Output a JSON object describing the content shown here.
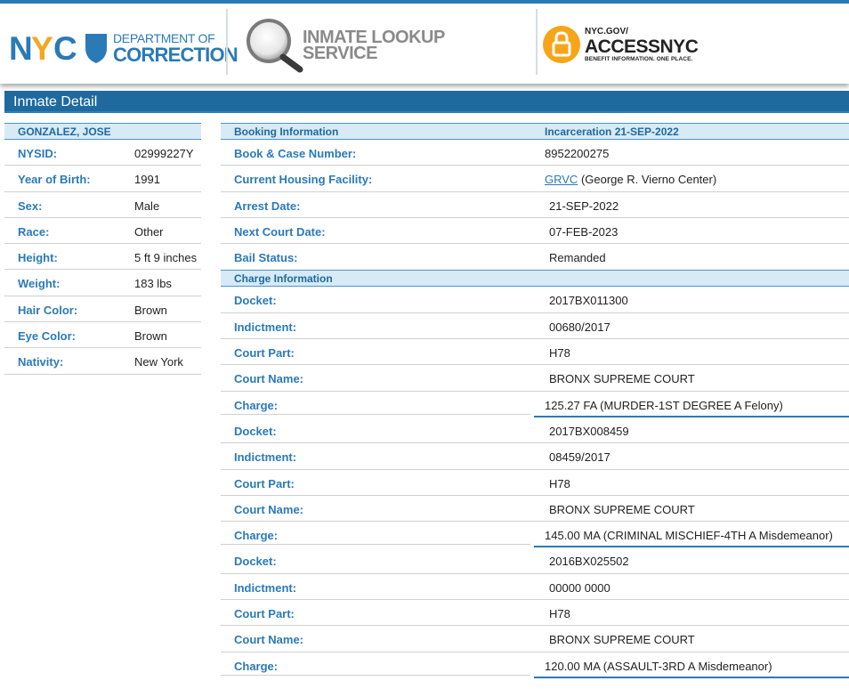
{
  "header": {
    "doc_line1": "DEPARTMENT OF",
    "doc_line2": "CORRECTION",
    "lookup_line1": "INMATE LOOKUP",
    "lookup_line2": "SERVICE",
    "access_line1": "NYC.GOV/",
    "access_line2": "ACCESSNYC",
    "access_line3": "BENEFIT INFORMATION. ONE PLACE.",
    "colors": {
      "brand_blue": "#2a7ab8",
      "nyc_orange": "#f5a623",
      "access_orange": "#f6a51b"
    }
  },
  "title": "Inmate Detail",
  "inmate": {
    "name": "GONZALEZ, JOSE",
    "fields": [
      {
        "label": "NYSID:",
        "value": "02999227Y"
      },
      {
        "label": "Year of Birth:",
        "value": "1991"
      },
      {
        "label": "Sex:",
        "value": "Male"
      },
      {
        "label": "Race:",
        "value": "Other"
      },
      {
        "label": "Height:",
        "value": "5 ft 9 inches"
      },
      {
        "label": "Weight:",
        "value": "183 lbs"
      },
      {
        "label": "Hair Color:",
        "value": "Brown"
      },
      {
        "label": "Eye Color:",
        "value": "Brown"
      },
      {
        "label": "Nativity:",
        "value": "New York"
      }
    ]
  },
  "booking": {
    "header_label": "Booking Information",
    "header_value": "Incarceration 21-SEP-2022",
    "book_case_label": "Book & Case Number:",
    "book_case_value": "8952200275",
    "facility_label": "Current Housing Facility:",
    "facility_link": "GRVC",
    "facility_name": "(George R. Vierno Center)",
    "arrest_label": "Arrest Date:",
    "arrest_value": "21-SEP-2022",
    "next_court_label": "Next Court Date:",
    "next_court_value": "07-FEB-2023",
    "bail_label": "Bail Status:",
    "bail_value": "Remanded"
  },
  "charges": {
    "header_label": "Charge Information",
    "labels": {
      "docket": "Docket:",
      "indictment": "Indictment:",
      "court_part": "Court Part:",
      "court_name": "Court Name:",
      "charge": "Charge:"
    },
    "items": [
      {
        "docket": "2017BX011300",
        "indictment": "00680/2017",
        "court_part": "H78",
        "court_name": "BRONX SUPREME COURT",
        "charge": "125.27 FA (MURDER-1ST DEGREE A Felony)"
      },
      {
        "docket": "2017BX008459",
        "indictment": "08459/2017",
        "court_part": "H78",
        "court_name": "BRONX SUPREME COURT",
        "charge": "145.00 MA (CRIMINAL MISCHIEF-4TH A Misdemeanor)"
      },
      {
        "docket": "2016BX025502",
        "indictment": "00000 0000",
        "court_part": "H78",
        "court_name": "BRONX SUPREME COURT",
        "charge": "120.00 MA (ASSAULT-3RD A Misdemeanor)"
      }
    ]
  }
}
